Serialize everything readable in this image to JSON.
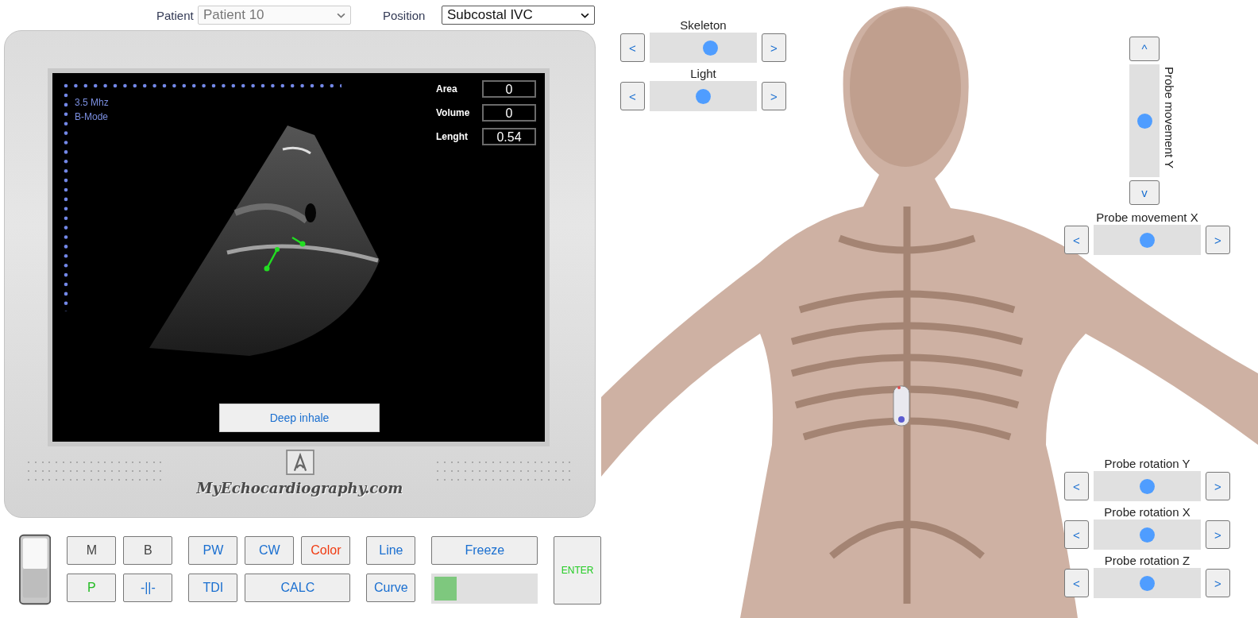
{
  "header": {
    "patient": {
      "label": "Patient",
      "value": "Patient 10",
      "disabled": true
    },
    "position": {
      "label": "Position",
      "value": "Subcostal IVC",
      "disabled": false
    }
  },
  "monitor": {
    "frequency": "3.5 Mhz",
    "mode": "B-Mode",
    "measurements": [
      {
        "label": "Area",
        "value": "0"
      },
      {
        "label": "Volume",
        "value": "0"
      },
      {
        "label": "Lenght",
        "value": "0.54"
      }
    ],
    "action_button": "Deep inhale",
    "brand": "MyEchocardiography.com"
  },
  "controls": {
    "button_groups": [
      [
        [
          {
            "label": "M",
            "color": "#444444",
            "kind": "normal"
          },
          {
            "label": "B",
            "color": "#444444",
            "kind": "normal"
          }
        ],
        [
          {
            "label": "P",
            "color": "#22bb22",
            "kind": "normal"
          },
          {
            "label": "-||-",
            "color": "#1a6fd0",
            "kind": "normal"
          }
        ]
      ],
      [
        [
          {
            "label": "PW",
            "color": "#1a6fd0",
            "kind": "normal"
          },
          {
            "label": "CW",
            "color": "#1a6fd0",
            "kind": "normal"
          },
          {
            "label": "Color",
            "color": "#f03a10",
            "kind": "normal"
          }
        ],
        [
          {
            "label": "TDI",
            "color": "#1a6fd0",
            "kind": "normal"
          },
          {
            "label": "CALC",
            "color": "#1a6fd0",
            "kind": "wide"
          }
        ]
      ],
      [
        [
          {
            "label": "Line",
            "color": "#1a6fd0",
            "kind": "normal"
          }
        ],
        [
          {
            "label": "Curve",
            "color": "#1a6fd0",
            "kind": "normal"
          }
        ]
      ]
    ],
    "freeze": {
      "label": "Freeze",
      "color": "#1a6fd0",
      "level": 0.22
    },
    "enter": {
      "label": "ENTER",
      "color": "#22cc22"
    }
  },
  "viewer": {
    "left_sliders": [
      {
        "label": "Skeleton",
        "decrease": "<",
        "increase": ">",
        "level": 0.57
      },
      {
        "label": "Light",
        "decrease": "<",
        "increase": ">",
        "level": 0.5
      }
    ],
    "movement_y": {
      "label": "Probe movement Y",
      "decrease": "v",
      "increase": "^",
      "level": 0.5
    },
    "movement_x": {
      "label": "Probe movement X",
      "decrease": "<",
      "increase": ">",
      "level": 0.5
    },
    "rotation_sliders": [
      {
        "label": "Probe rotation Y",
        "decrease": "<",
        "increase": ">",
        "level": 0.5
      },
      {
        "label": "Probe rotation X",
        "decrease": "<",
        "increase": ">",
        "level": 0.5
      },
      {
        "label": "Probe rotation Z",
        "decrease": "<",
        "increase": ">",
        "level": 0.5
      }
    ]
  }
}
